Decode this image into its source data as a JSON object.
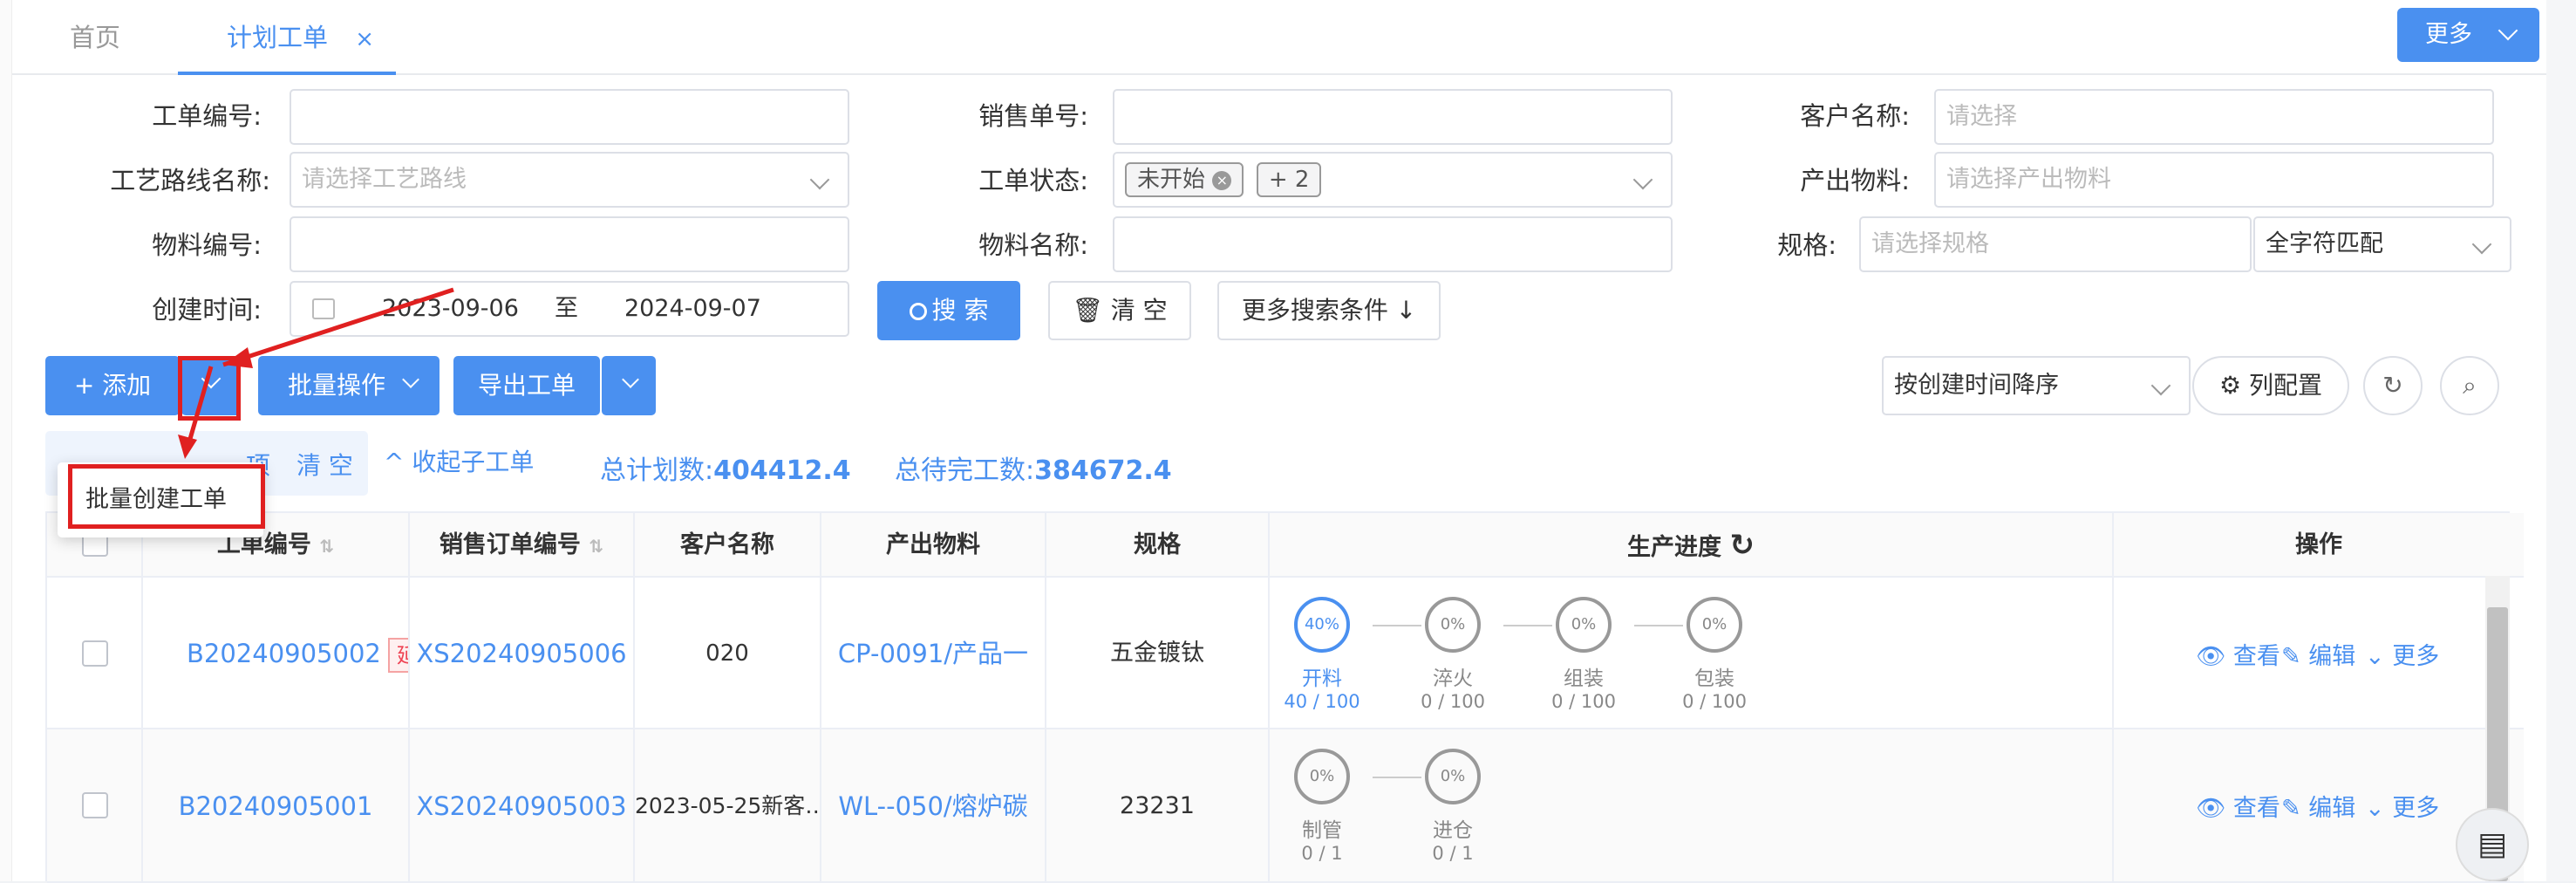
{
  "tabs": [
    {
      "label": "首页"
    },
    {
      "label": "计划工单",
      "close": "×"
    }
  ],
  "header_more": "更多",
  "form": {
    "order_no": {
      "label": "工单编号:",
      "placeholder": ""
    },
    "sales_no": {
      "label": "销售单号:",
      "placeholder": ""
    },
    "customer": {
      "label": "客户名称:",
      "placeholder": "请选择"
    },
    "route": {
      "label": "工艺路线名称:",
      "placeholder": "请选择工艺路线"
    },
    "status": {
      "label": "工单状态:",
      "tags": [
        "未开始",
        "+ 2"
      ]
    },
    "output": {
      "label": "产出物料:",
      "placeholder": "请选择产出物料"
    },
    "mat_no": {
      "label": "物料编号:",
      "placeholder": ""
    },
    "mat_name": {
      "label": "物料名称:",
      "placeholder": ""
    },
    "spec": {
      "label": "规格:",
      "placeholder": "请选择规格",
      "match": "全字符匹配"
    },
    "created": {
      "label": "创建时间:",
      "start": "2023-09-06",
      "sep": "至",
      "end": "2024-09-07"
    }
  },
  "buttons": {
    "search": "搜 索",
    "clear": "清 空",
    "more_search": "更多搜索条件 ↓",
    "add": "+ 添加",
    "batch": "批量操作",
    "export": "导出工单",
    "sort": "按创建时间降序",
    "columns": "列配置"
  },
  "selection": {
    "suffix": "项",
    "clear": "清 空",
    "collapse": "^ 收起子工单"
  },
  "stats": {
    "planned_label": "总计划数:",
    "planned": "404412.4",
    "pending_label": "总待完工数:",
    "pending": "384672.4"
  },
  "dropdown_item": "批量创建工单",
  "columns": {
    "order_no": "工单编号",
    "sales_no": "销售订单编号",
    "customer": "客户名称",
    "output": "产出物料",
    "spec": "规格",
    "progress": "生产进度",
    "ops": "操作"
  },
  "rows": [
    {
      "order_no": "B20240905002",
      "badge": "延",
      "sales_no": "XS20240905006",
      "customer": "020",
      "output": "CP-0091/产品一",
      "spec": "五金镀钛",
      "steps": [
        {
          "pct": "40%",
          "name": "开料",
          "qty": "40 / 100"
        },
        {
          "pct": "0%",
          "name": "淬火",
          "qty": "0 / 100"
        },
        {
          "pct": "0%",
          "name": "组装",
          "qty": "0 / 100"
        },
        {
          "pct": "0%",
          "name": "包装",
          "qty": "0 / 100"
        }
      ]
    },
    {
      "order_no": "B20240905001",
      "sales_no": "XS20240905003",
      "customer": "2023-05-25新客…",
      "output": "WL--050/熔炉碳",
      "spec": "23231",
      "steps": [
        {
          "pct": "0%",
          "name": "制管",
          "qty": "0 / 1"
        },
        {
          "pct": "0%",
          "name": "进仓",
          "qty": "0 / 1"
        }
      ]
    }
  ],
  "row_actions": {
    "view": "查看",
    "edit": "编辑",
    "more": "更多"
  }
}
